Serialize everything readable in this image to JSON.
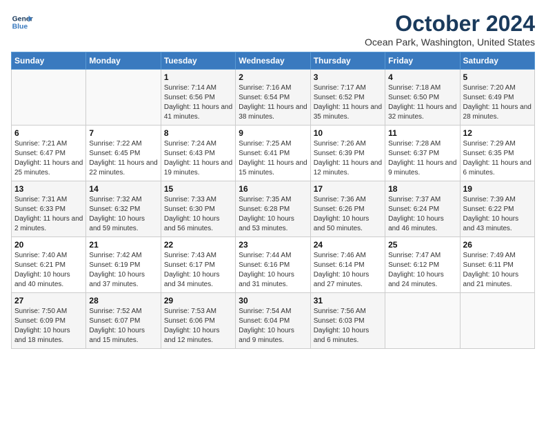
{
  "header": {
    "logo_line1": "General",
    "logo_line2": "Blue",
    "month_title": "October 2024",
    "location": "Ocean Park, Washington, United States"
  },
  "weekdays": [
    "Sunday",
    "Monday",
    "Tuesday",
    "Wednesday",
    "Thursday",
    "Friday",
    "Saturday"
  ],
  "weeks": [
    [
      {
        "day": "",
        "info": ""
      },
      {
        "day": "",
        "info": ""
      },
      {
        "day": "1",
        "info": "Sunrise: 7:14 AM\nSunset: 6:56 PM\nDaylight: 11 hours and 41 minutes."
      },
      {
        "day": "2",
        "info": "Sunrise: 7:16 AM\nSunset: 6:54 PM\nDaylight: 11 hours and 38 minutes."
      },
      {
        "day": "3",
        "info": "Sunrise: 7:17 AM\nSunset: 6:52 PM\nDaylight: 11 hours and 35 minutes."
      },
      {
        "day": "4",
        "info": "Sunrise: 7:18 AM\nSunset: 6:50 PM\nDaylight: 11 hours and 32 minutes."
      },
      {
        "day": "5",
        "info": "Sunrise: 7:20 AM\nSunset: 6:49 PM\nDaylight: 11 hours and 28 minutes."
      }
    ],
    [
      {
        "day": "6",
        "info": "Sunrise: 7:21 AM\nSunset: 6:47 PM\nDaylight: 11 hours and 25 minutes."
      },
      {
        "day": "7",
        "info": "Sunrise: 7:22 AM\nSunset: 6:45 PM\nDaylight: 11 hours and 22 minutes."
      },
      {
        "day": "8",
        "info": "Sunrise: 7:24 AM\nSunset: 6:43 PM\nDaylight: 11 hours and 19 minutes."
      },
      {
        "day": "9",
        "info": "Sunrise: 7:25 AM\nSunset: 6:41 PM\nDaylight: 11 hours and 15 minutes."
      },
      {
        "day": "10",
        "info": "Sunrise: 7:26 AM\nSunset: 6:39 PM\nDaylight: 11 hours and 12 minutes."
      },
      {
        "day": "11",
        "info": "Sunrise: 7:28 AM\nSunset: 6:37 PM\nDaylight: 11 hours and 9 minutes."
      },
      {
        "day": "12",
        "info": "Sunrise: 7:29 AM\nSunset: 6:35 PM\nDaylight: 11 hours and 6 minutes."
      }
    ],
    [
      {
        "day": "13",
        "info": "Sunrise: 7:31 AM\nSunset: 6:33 PM\nDaylight: 11 hours and 2 minutes."
      },
      {
        "day": "14",
        "info": "Sunrise: 7:32 AM\nSunset: 6:32 PM\nDaylight: 10 hours and 59 minutes."
      },
      {
        "day": "15",
        "info": "Sunrise: 7:33 AM\nSunset: 6:30 PM\nDaylight: 10 hours and 56 minutes."
      },
      {
        "day": "16",
        "info": "Sunrise: 7:35 AM\nSunset: 6:28 PM\nDaylight: 10 hours and 53 minutes."
      },
      {
        "day": "17",
        "info": "Sunrise: 7:36 AM\nSunset: 6:26 PM\nDaylight: 10 hours and 50 minutes."
      },
      {
        "day": "18",
        "info": "Sunrise: 7:37 AM\nSunset: 6:24 PM\nDaylight: 10 hours and 46 minutes."
      },
      {
        "day": "19",
        "info": "Sunrise: 7:39 AM\nSunset: 6:22 PM\nDaylight: 10 hours and 43 minutes."
      }
    ],
    [
      {
        "day": "20",
        "info": "Sunrise: 7:40 AM\nSunset: 6:21 PM\nDaylight: 10 hours and 40 minutes."
      },
      {
        "day": "21",
        "info": "Sunrise: 7:42 AM\nSunset: 6:19 PM\nDaylight: 10 hours and 37 minutes."
      },
      {
        "day": "22",
        "info": "Sunrise: 7:43 AM\nSunset: 6:17 PM\nDaylight: 10 hours and 34 minutes."
      },
      {
        "day": "23",
        "info": "Sunrise: 7:44 AM\nSunset: 6:16 PM\nDaylight: 10 hours and 31 minutes."
      },
      {
        "day": "24",
        "info": "Sunrise: 7:46 AM\nSunset: 6:14 PM\nDaylight: 10 hours and 27 minutes."
      },
      {
        "day": "25",
        "info": "Sunrise: 7:47 AM\nSunset: 6:12 PM\nDaylight: 10 hours and 24 minutes."
      },
      {
        "day": "26",
        "info": "Sunrise: 7:49 AM\nSunset: 6:11 PM\nDaylight: 10 hours and 21 minutes."
      }
    ],
    [
      {
        "day": "27",
        "info": "Sunrise: 7:50 AM\nSunset: 6:09 PM\nDaylight: 10 hours and 18 minutes."
      },
      {
        "day": "28",
        "info": "Sunrise: 7:52 AM\nSunset: 6:07 PM\nDaylight: 10 hours and 15 minutes."
      },
      {
        "day": "29",
        "info": "Sunrise: 7:53 AM\nSunset: 6:06 PM\nDaylight: 10 hours and 12 minutes."
      },
      {
        "day": "30",
        "info": "Sunrise: 7:54 AM\nSunset: 6:04 PM\nDaylight: 10 hours and 9 minutes."
      },
      {
        "day": "31",
        "info": "Sunrise: 7:56 AM\nSunset: 6:03 PM\nDaylight: 10 hours and 6 minutes."
      },
      {
        "day": "",
        "info": ""
      },
      {
        "day": "",
        "info": ""
      }
    ]
  ]
}
